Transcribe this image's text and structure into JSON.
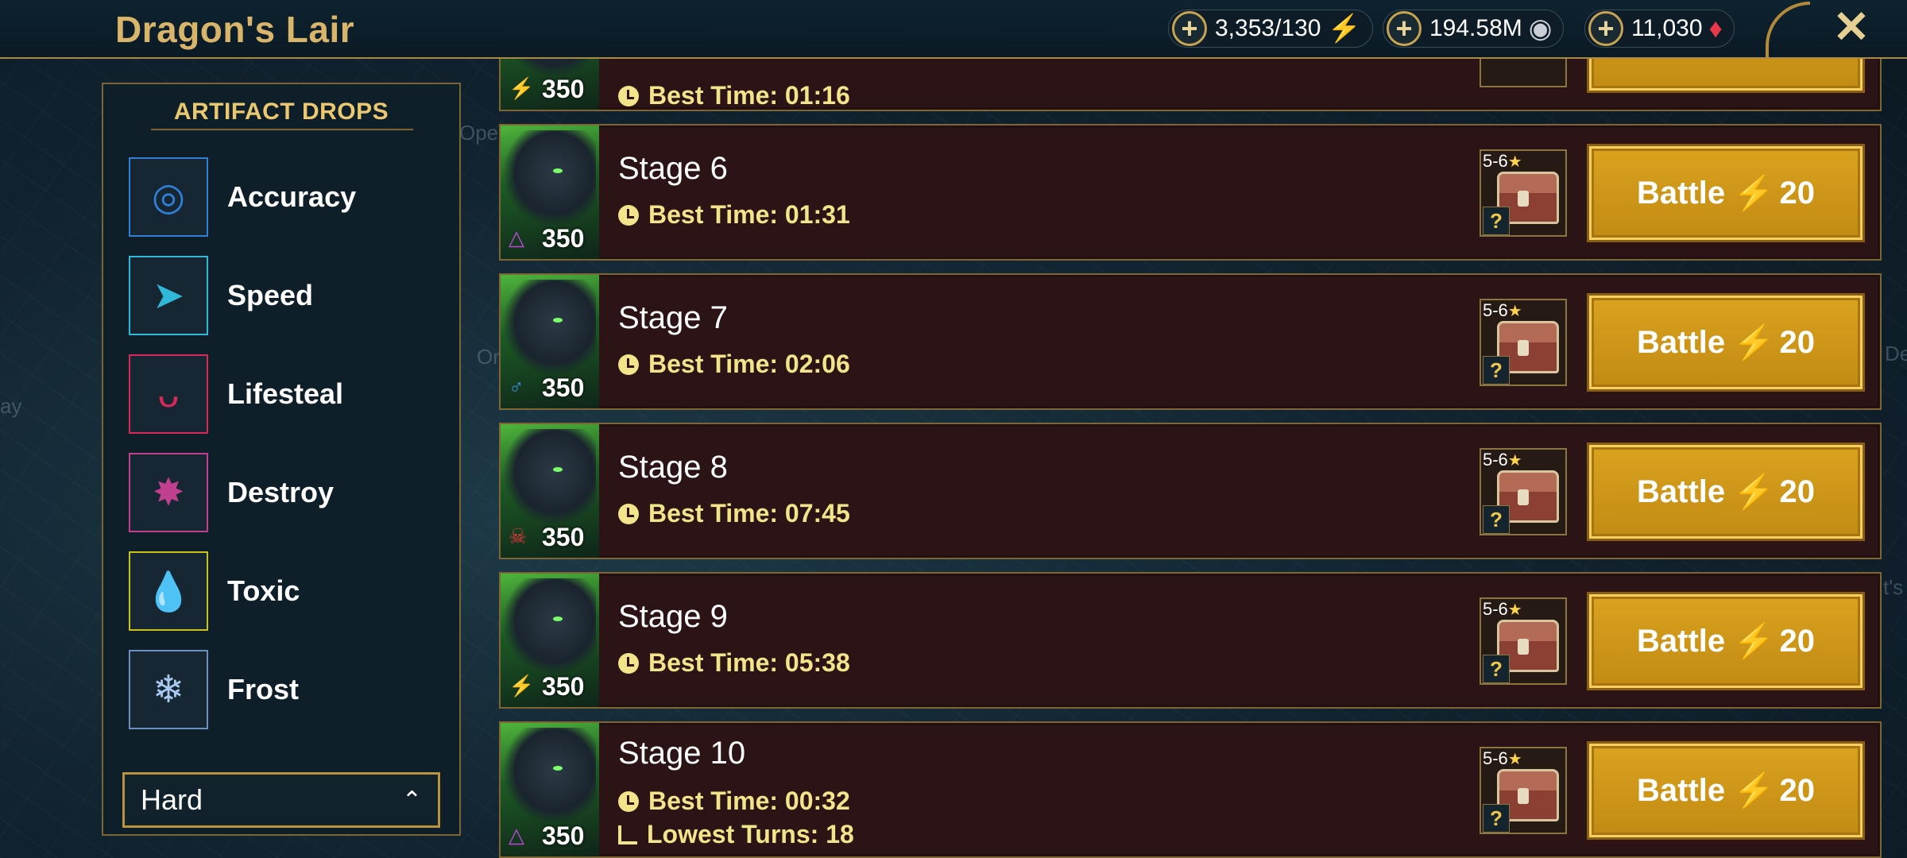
{
  "header": {
    "title": "Dragon's Lair",
    "resources": [
      {
        "value": "3,353/130",
        "icon": "energy-bolt-icon",
        "glyph": "⚡"
      },
      {
        "value": "194.58M",
        "icon": "silver-coin-icon",
        "glyph": "◉"
      },
      {
        "value": "11,030",
        "icon": "gem-icon",
        "glyph": "♦"
      }
    ],
    "close_glyph": "✕"
  },
  "background_labels": [
    "Open",
    "Or",
    "ay",
    "De",
    "t's"
  ],
  "panel": {
    "title": "ARTIFACT DROPS",
    "drops": [
      {
        "label": "Accuracy",
        "glyph": "◎",
        "color": "#2f7fd6"
      },
      {
        "label": "Speed",
        "glyph": "➤",
        "color": "#2fb8d8"
      },
      {
        "label": "Lifesteal",
        "glyph": "ᴗ",
        "color": "#d8285a"
      },
      {
        "label": "Destroy",
        "glyph": "✸",
        "color": "#c0408f"
      },
      {
        "label": "Toxic",
        "glyph": "💧",
        "color": "#c8c21a"
      },
      {
        "label": "Frost",
        "glyph": "❄",
        "color": "#6c8fbf"
      }
    ],
    "difficulty": "Hard",
    "chevron": "⌃"
  },
  "stages": {
    "partial_best_time": "Best Time: 01:16",
    "partial_power": "350",
    "rows": [
      {
        "name": "Stage 6",
        "best_time": "Best Time: 01:31",
        "power": "350",
        "affinity": "△",
        "affinity_color": "#c046e0",
        "reward_rank": "5-6",
        "battle_label": "Battle",
        "cost": "20"
      },
      {
        "name": "Stage 7",
        "best_time": "Best Time: 02:06",
        "power": "350",
        "affinity": "♂",
        "affinity_color": "#3a8fe8",
        "reward_rank": "5-6",
        "battle_label": "Battle",
        "cost": "20"
      },
      {
        "name": "Stage 8",
        "best_time": "Best Time: 07:45",
        "power": "350",
        "affinity": "☠",
        "affinity_color": "#e03a3a",
        "reward_rank": "5-6",
        "battle_label": "Battle",
        "cost": "20"
      },
      {
        "name": "Stage 9",
        "best_time": "Best Time: 05:38",
        "power": "350",
        "affinity": "⚡",
        "affinity_color": "#3ed24a",
        "reward_rank": "5-6",
        "battle_label": "Battle",
        "cost": "20"
      },
      {
        "name": "Stage 10",
        "best_time": "Best Time: 00:32",
        "lowest_turns": "Lowest Turns: 18",
        "power": "350",
        "affinity": "△",
        "affinity_color": "#c046e0",
        "reward_rank": "5-6",
        "battle_label": "Battle",
        "cost": "20"
      }
    ]
  },
  "colors": {
    "gold_accent": "#d8b56a",
    "row_bg": "#2c1416",
    "button_gold": "#d9a21e",
    "best_time_text": "#f1e48a"
  }
}
